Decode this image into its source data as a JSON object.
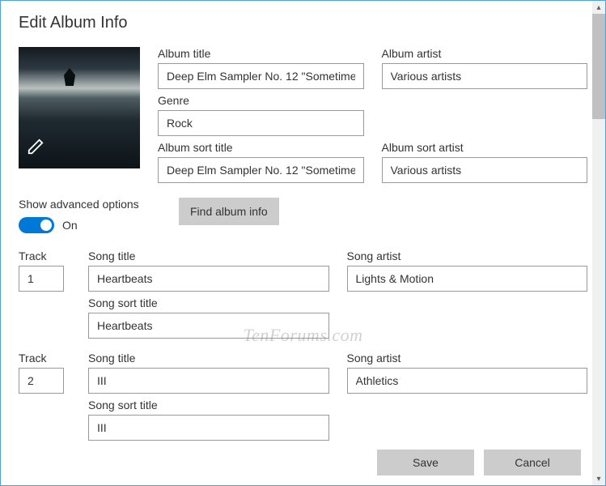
{
  "title": "Edit Album Info",
  "album": {
    "title_label": "Album title",
    "title_value": "Deep Elm Sampler No. 12 \"Sometime",
    "artist_label": "Album artist",
    "artist_value": "Various artists",
    "genre_label": "Genre",
    "genre_value": "Rock",
    "sort_title_label": "Album sort title",
    "sort_title_value": "Deep Elm Sampler No. 12 \"Sometime",
    "sort_artist_label": "Album sort artist",
    "sort_artist_value": "Various artists"
  },
  "advanced": {
    "label": "Show advanced options",
    "state": "On",
    "find_button": "Find album info"
  },
  "columns": {
    "track": "Track",
    "song_title": "Song title",
    "song_artist": "Song artist",
    "song_sort_title": "Song sort title"
  },
  "tracks": [
    {
      "num": "1",
      "title": "Heartbeats",
      "artist": "Lights & Motion",
      "sort_title": "Heartbeats"
    },
    {
      "num": "2",
      "title": "III",
      "artist": "Athletics",
      "sort_title": "III"
    }
  ],
  "footer": {
    "save": "Save",
    "cancel": "Cancel"
  },
  "watermark": "TenForums.com"
}
